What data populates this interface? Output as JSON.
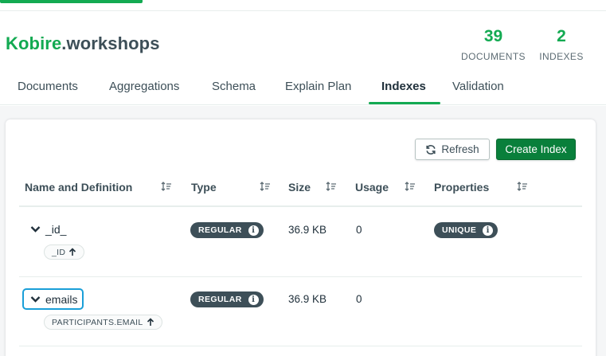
{
  "namespace": {
    "database": "Kobire",
    "collection": ".workshops"
  },
  "stats": [
    {
      "value": "39",
      "label": "DOCUMENTS"
    },
    {
      "value": "2",
      "label": "INDEXES"
    }
  ],
  "tabs": [
    {
      "label": "Documents",
      "active": false
    },
    {
      "label": "Aggregations",
      "active": false
    },
    {
      "label": "Schema",
      "active": false
    },
    {
      "label": "Explain Plan",
      "active": false
    },
    {
      "label": "Indexes",
      "active": true
    },
    {
      "label": "Validation",
      "active": false
    }
  ],
  "toolbar": {
    "refresh_label": "Refresh",
    "create_label": "Create Index"
  },
  "table": {
    "columns": [
      "Name and Definition",
      "Type",
      "Size",
      "Usage",
      "Properties"
    ],
    "rows": [
      {
        "name": "_id_",
        "key": "_ID",
        "key_direction": "ascending",
        "type": "REGULAR",
        "size": "36.9 KB",
        "usage": "0",
        "property": "UNIQUE"
      },
      {
        "name": "emails",
        "key": "PARTICIPANTS.EMAIL",
        "key_direction": "ascending",
        "type": "REGULAR",
        "size": "36.9 KB",
        "usage": "0",
        "property": ""
      }
    ]
  },
  "icons": {
    "refresh": "refresh-icon",
    "sort": "sort-icon",
    "expand": "chevron-down-icon",
    "info": "info-icon",
    "arrow": "arrow-up-icon"
  },
  "colors": {
    "brand": "#13aa52",
    "primary_button": "#097f3b",
    "badge": "#3d4f58",
    "focus": "#1a9fd8"
  }
}
